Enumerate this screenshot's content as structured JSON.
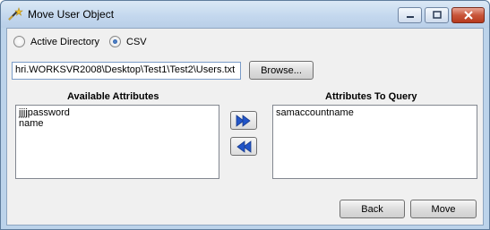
{
  "window": {
    "title": "Move User Object"
  },
  "source": {
    "options": [
      {
        "label": "Active Directory",
        "selected": false
      },
      {
        "label": "CSV",
        "selected": true
      }
    ]
  },
  "path": {
    "value": "hri.WORKSVR2008\\Desktop\\Test1\\Test2\\Users.txt",
    "browse_label": "Browse..."
  },
  "available": {
    "header": "Available Attributes",
    "items": [
      "jjjjpassword",
      "name"
    ]
  },
  "query": {
    "header": "Attributes To Query",
    "items": [
      "samaccountname"
    ]
  },
  "buttons": {
    "back": "Back",
    "move": "Move"
  },
  "icons": {
    "app": "wand-icon",
    "add": "double-arrow-right-icon",
    "remove": "double-arrow-left-icon",
    "accent": "#2255c8"
  }
}
